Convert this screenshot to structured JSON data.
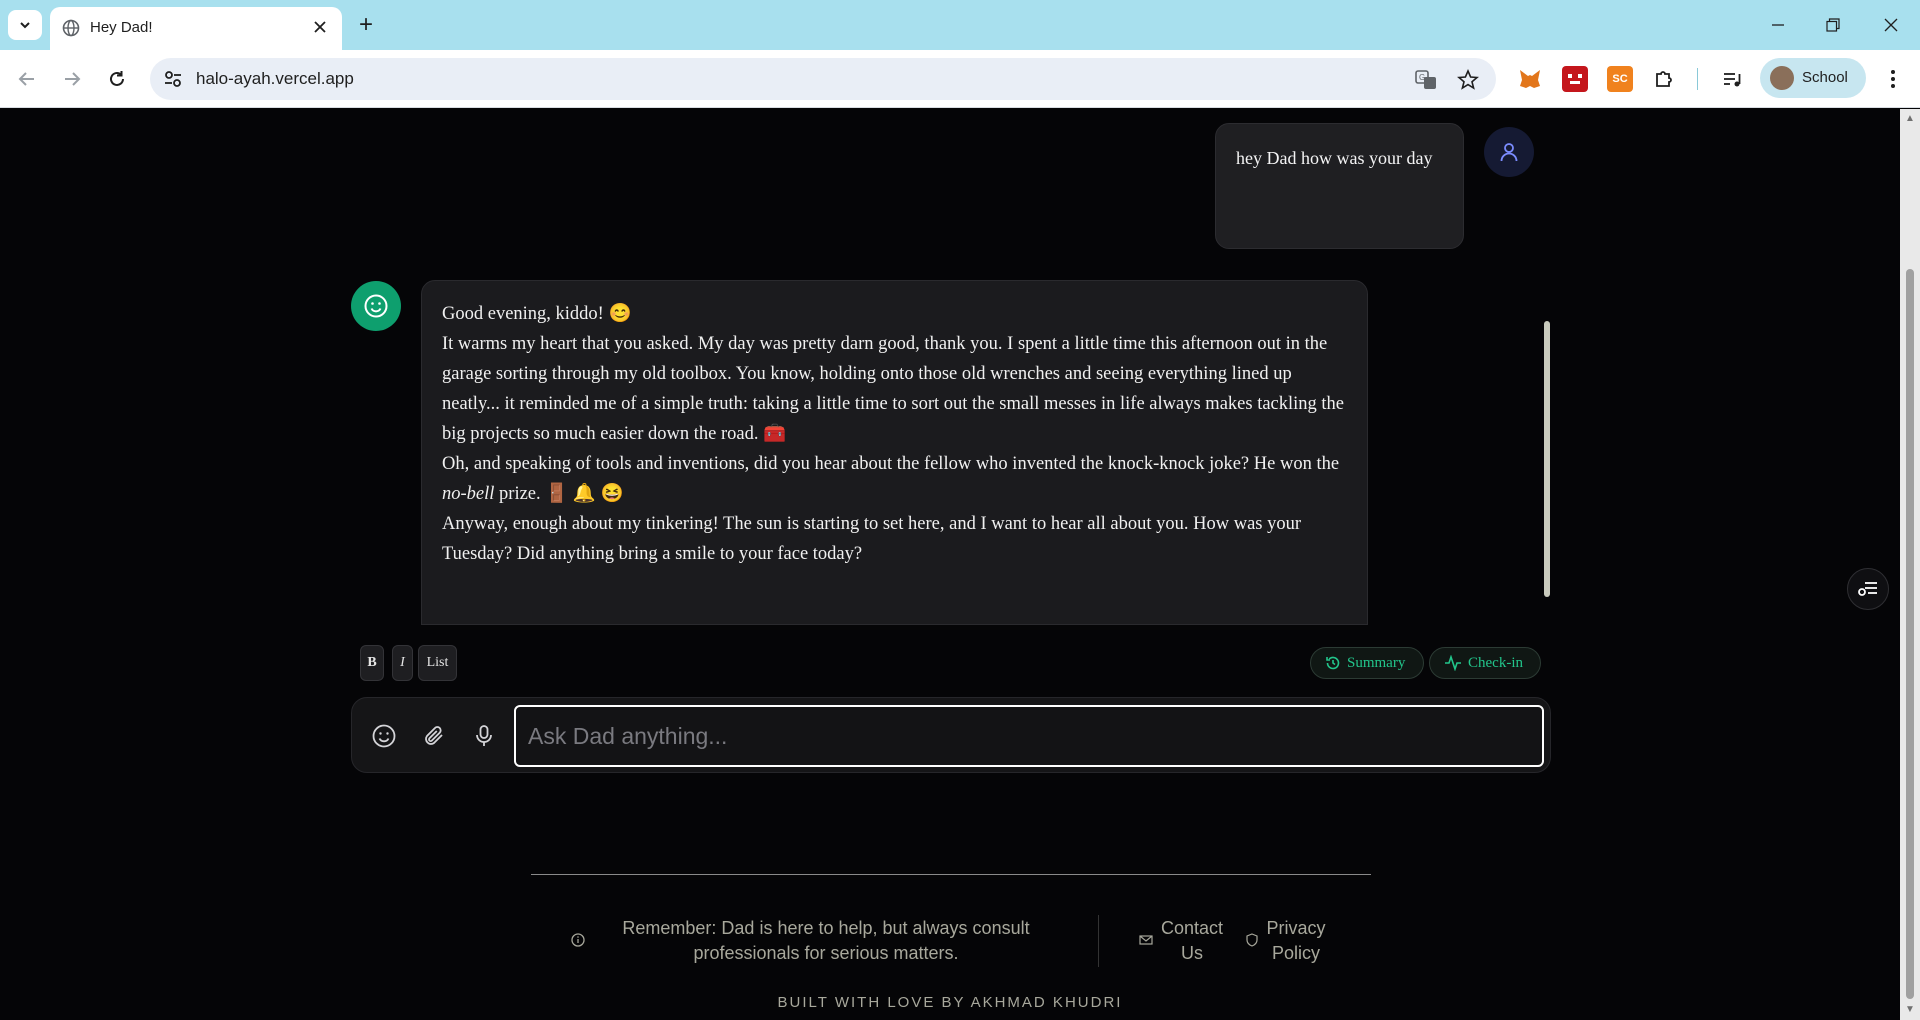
{
  "browser": {
    "tab_title": "Hey Dad!",
    "new_tab_label": "+",
    "url": "halo-ayah.vercel.app",
    "profile_label": "School",
    "extensions": [
      {
        "name": "metamask-extension-icon",
        "color": "#e2761b"
      },
      {
        "name": "red-extension-icon",
        "color": "#c4161c"
      },
      {
        "name": "sc-extension-icon",
        "color": "#f0821e",
        "label": "SC"
      }
    ]
  },
  "chat": {
    "user_message": "hey Dad how was your day",
    "dad_message": {
      "greeting": "Good evening, kiddo! 😊",
      "para1": "It warms my heart that you asked. My day was pretty darn good, thank you. I spent a little time this afternoon out in the garage sorting through my old toolbox. You know, holding onto those old wrenches and seeing everything lined up neatly... it reminded me of a simple truth: taking a little time to sort out the small messes in life always makes tackling the big projects so much easier down the road. 🧰",
      "para2_before": "Oh, and speaking of tools and inventions, did you hear about the fellow who invented the knock-knock joke? He won the ",
      "para2_italic": "no-bell",
      "para2_after": " prize. 🚪 🔔 😆",
      "para3": "Anyway, enough about my tinkering! The sun is starting to set here, and I want to hear all about you. How was your Tuesday? Did anything bring a smile to your face today?"
    }
  },
  "formatting": {
    "bold_label": "B",
    "italic_label": "I",
    "list_label": "List"
  },
  "actions": {
    "summary_label": "Summary",
    "checkin_label": "Check-in",
    "accent": "#22c58b"
  },
  "composer": {
    "placeholder": "Ask Dad anything...",
    "value": ""
  },
  "footer": {
    "disclaimer": "Remember: Dad is here to help, but always consult professionals for serious matters.",
    "contact_label": "Contact Us",
    "privacy_label": "Privacy Policy",
    "built_by": "BUILT WITH LOVE BY AKHMAD KHUDRI"
  }
}
